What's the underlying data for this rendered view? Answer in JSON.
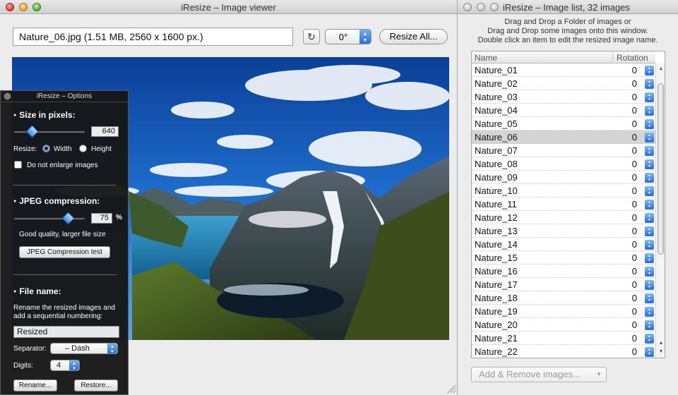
{
  "viewer": {
    "title": "iResize – Image viewer",
    "file_info": "Nature_06.jpg  (1.51 MB, 2560 x 1600 px.)",
    "rotate_glyph": "↻",
    "angle": "0°",
    "resize_all": "Resize All..."
  },
  "options": {
    "title": "iResize – Options",
    "size_heading": "Size in pixels:",
    "size_value": "640",
    "size_slider_fraction": 0.25,
    "resize_label": "Resize:",
    "width_label": "Width",
    "height_label": "Height",
    "resize_by": "Width",
    "no_enlarge_label": "Do not enlarge images",
    "no_enlarge_checked": false,
    "jpeg_heading": "JPEG compression:",
    "jpeg_value": "75",
    "jpeg_unit": "%",
    "jpeg_slider_fraction": 0.75,
    "quality_text": "Good quality, larger file size",
    "jpeg_test": "JPEG Compression test",
    "filename_heading": "File name:",
    "rename_desc_1": "Rename the resized images and",
    "rename_desc_2": "add a sequential numbering:",
    "base_name": "Resized",
    "separator_label": "Separator:",
    "separator_value": "– Dash",
    "digits_label": "Digits:",
    "digits_value": "4",
    "rename_btn": "Rename...",
    "restore_btn": "Restore..."
  },
  "list": {
    "title": "iResize – Image list, 32 images",
    "hint_1": "Drag and Drop a Folder of images or",
    "hint_2": "Drag and Drop some images onto this window.",
    "hint_3": "Double click an item to edit the resized image name.",
    "col_name": "Name",
    "col_rotation": "Rotation",
    "selected": "Nature_06",
    "rows": [
      {
        "name": "Nature_01",
        "rotation": "0"
      },
      {
        "name": "Nature_02",
        "rotation": "0"
      },
      {
        "name": "Nature_03",
        "rotation": "0"
      },
      {
        "name": "Nature_04",
        "rotation": "0"
      },
      {
        "name": "Nature_05",
        "rotation": "0"
      },
      {
        "name": "Nature_06",
        "rotation": "0"
      },
      {
        "name": "Nature_07",
        "rotation": "0"
      },
      {
        "name": "Nature_08",
        "rotation": "0"
      },
      {
        "name": "Nature_09",
        "rotation": "0"
      },
      {
        "name": "Nature_10",
        "rotation": "0"
      },
      {
        "name": "Nature_11",
        "rotation": "0"
      },
      {
        "name": "Nature_12",
        "rotation": "0"
      },
      {
        "name": "Nature_13",
        "rotation": "0"
      },
      {
        "name": "Nature_14",
        "rotation": "0"
      },
      {
        "name": "Nature_15",
        "rotation": "0"
      },
      {
        "name": "Nature_16",
        "rotation": "0"
      },
      {
        "name": "Nature_17",
        "rotation": "0"
      },
      {
        "name": "Nature_18",
        "rotation": "0"
      },
      {
        "name": "Nature_19",
        "rotation": "0"
      },
      {
        "name": "Nature_20",
        "rotation": "0"
      },
      {
        "name": "Nature_21",
        "rotation": "0"
      },
      {
        "name": "Nature_22",
        "rotation": "0"
      }
    ],
    "add_remove": "Add & Remove images..."
  },
  "colors": {
    "accent": "#3b86e0",
    "selection": "#d4d4d4",
    "panel": "#161616"
  }
}
